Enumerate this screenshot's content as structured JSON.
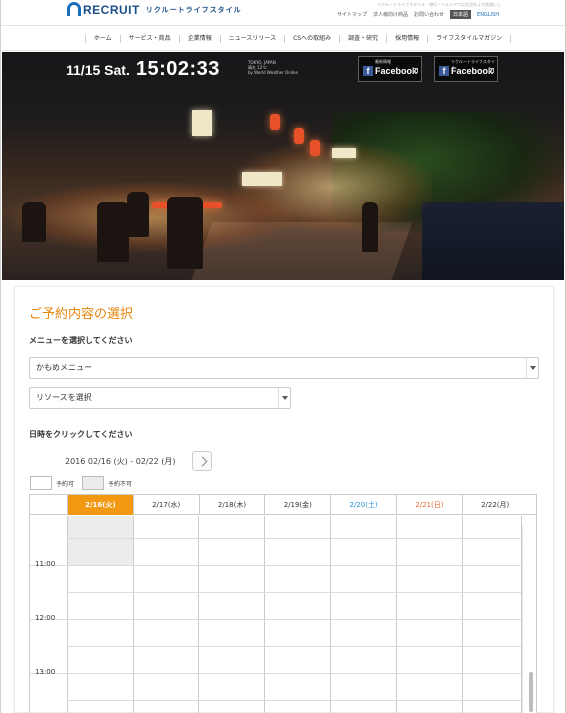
{
  "header": {
    "logo_text": "RECRUIT",
    "logo_jp": "リクルートライフスタイル",
    "tagline": "リクルートライフスタイル・旅行・ヘルシアでは生活をより快適にし",
    "utils": [
      "サイトマップ",
      "法人様向け商品",
      "お問い合わせ"
    ],
    "lang_ja": "日本語",
    "lang_en": "ENGLISH"
  },
  "nav": {
    "items": [
      "ホーム",
      "サービス・商品",
      "企業情報",
      "ニュースリリース",
      "CSへの取組み",
      "調査・研究",
      "採用情報",
      "ライフスタイルマガジン"
    ]
  },
  "hero": {
    "date": "11/15 Sat.",
    "time": "15:02:33",
    "sub": [
      "TOKYO, JAPAN",
      "晴れ 12℃",
      "by World Weather Online"
    ],
    "fb1_caption": "最新情報",
    "fb2_caption": "リクルートライフスタイル",
    "fb_label": "Facebook"
  },
  "reservation": {
    "title": "ご予約内容の選択",
    "menu_label": "メニューを選択してください",
    "menu_value": "かもめメニュー",
    "resource_value": "リソースを選択",
    "datetime_label": "日時をクリックしてください",
    "date_range": "2016 02/16 (火) - 02/22 (月)",
    "legend_available": "予約可",
    "legend_unavailable": "予約不可"
  },
  "calendar": {
    "days": [
      {
        "label": "2/16(火)",
        "type": "today"
      },
      {
        "label": "2/17(水)",
        "type": "weekday"
      },
      {
        "label": "2/18(木)",
        "type": "weekday"
      },
      {
        "label": "2/19(金)",
        "type": "weekday"
      },
      {
        "label": "2/20(土)",
        "type": "sat"
      },
      {
        "label": "2/21(日)",
        "type": "sun"
      },
      {
        "label": "2/22(月)",
        "type": "weekday"
      }
    ],
    "hours": [
      "11:00",
      "12:00",
      "13:00"
    ]
  },
  "colors": {
    "accent": "#f39813",
    "title": "#e8850c",
    "saturday": "#2a8fd6",
    "sunday": "#e8642a",
    "brand": "#1a4f8a"
  }
}
